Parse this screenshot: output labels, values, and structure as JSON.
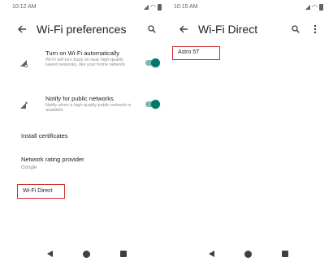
{
  "left_screen": {
    "status_bar": {
      "time": "10:12 AM"
    },
    "app_bar": {
      "title": "Wi-Fi preferences"
    },
    "settings": [
      {
        "title": "Turn on Wi-Fi automatically",
        "description": "Wi-Fi will turn back on near high-quality saved networks, like your home network",
        "icon": "wifi-auto-icon",
        "toggle_on": true
      },
      {
        "title": "Notify for public networks",
        "description": "Notify when a high-quality public network is available",
        "icon": "wifi-notify-icon",
        "toggle_on": true
      }
    ],
    "install_certificates": "Install certificates",
    "network_rating_provider": {
      "title": "Network rating provider",
      "value": "Google"
    },
    "wifi_direct": "Wi-Fi Direct"
  },
  "right_screen": {
    "status_bar": {
      "time": "10:15 AM"
    },
    "app_bar": {
      "title": "Wi-Fi Direct"
    },
    "peer_devices": [
      "Astro 5T"
    ]
  },
  "colors": {
    "accent": "#00796b",
    "highlight": "#d32f2f"
  }
}
